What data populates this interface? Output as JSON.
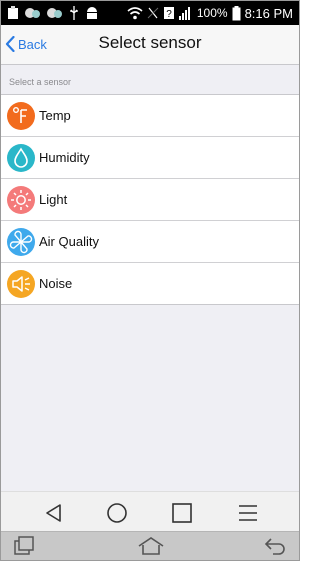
{
  "status_bar": {
    "battery_percent": "100%",
    "time": "8:16 PM"
  },
  "header": {
    "back_label": "Back",
    "title": "Select sensor"
  },
  "section_label": "Select a sensor",
  "sensors": [
    {
      "label": "Temp",
      "icon": "temperature-icon",
      "color": "#f26b1d"
    },
    {
      "label": "Humidity",
      "icon": "water-drop-icon",
      "color": "#2ab7c9"
    },
    {
      "label": "Light",
      "icon": "sun-icon",
      "color": "#f47a7a"
    },
    {
      "label": "Air Quality",
      "icon": "fan-icon",
      "color": "#3fa9ec"
    },
    {
      "label": "Noise",
      "icon": "speaker-icon",
      "color": "#f5a623"
    }
  ],
  "colors": {
    "accent": "#2a7ae2",
    "background": "#efeff4"
  }
}
